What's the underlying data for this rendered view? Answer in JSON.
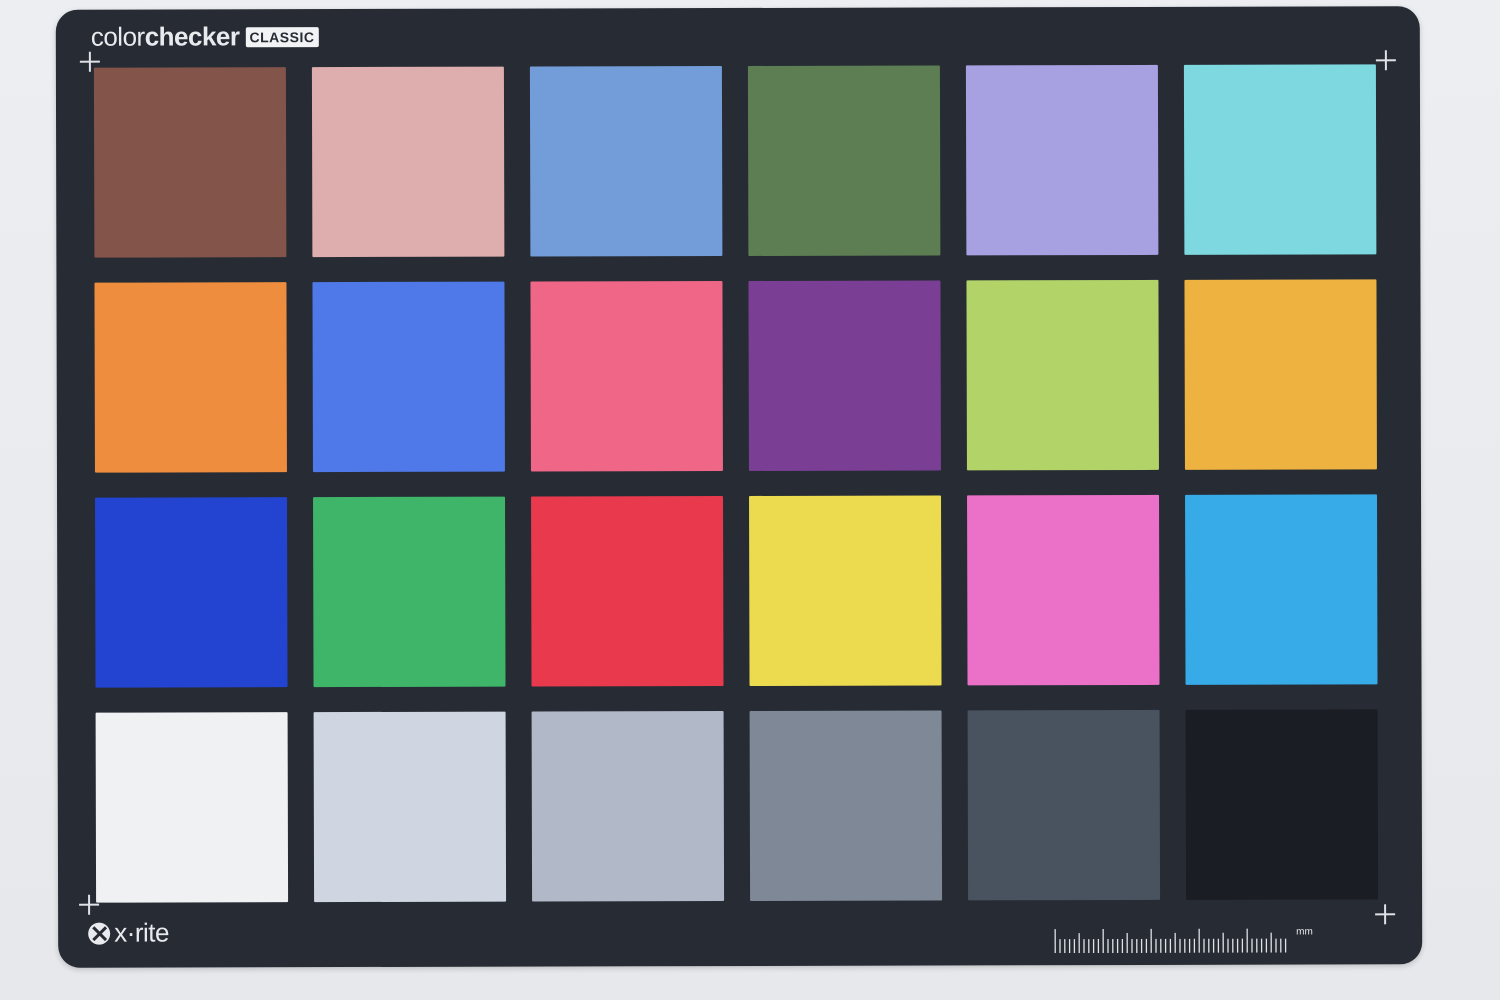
{
  "card": {
    "brand_light": "color",
    "brand_bold": "checker",
    "brand_badge": "CLASSIC",
    "maker": "x·rite",
    "ruler_unit": "mm",
    "background_color": "#262b34"
  },
  "patches": [
    {
      "color": "#82544a"
    },
    {
      "color": "#deaeae"
    },
    {
      "color": "#729dd9"
    },
    {
      "color": "#5c7e52"
    },
    {
      "color": "#a7a0e1"
    },
    {
      "color": "#7dd8e0"
    },
    {
      "color": "#ee8d3d"
    },
    {
      "color": "#4f78e8"
    },
    {
      "color": "#ef6687"
    },
    {
      "color": "#7a3f95"
    },
    {
      "color": "#b2d368"
    },
    {
      "color": "#edb23f"
    },
    {
      "color": "#2244d1"
    },
    {
      "color": "#3fb56a"
    },
    {
      "color": "#e8394d"
    },
    {
      "color": "#eddb4f"
    },
    {
      "color": "#ea70c8"
    },
    {
      "color": "#36abe8"
    },
    {
      "color": "#eff1f3"
    },
    {
      "color": "#cfd6e2"
    },
    {
      "color": "#b1b9c8"
    },
    {
      "color": "#7f8897"
    },
    {
      "color": "#49525f"
    },
    {
      "color": "#1a1d23"
    }
  ]
}
